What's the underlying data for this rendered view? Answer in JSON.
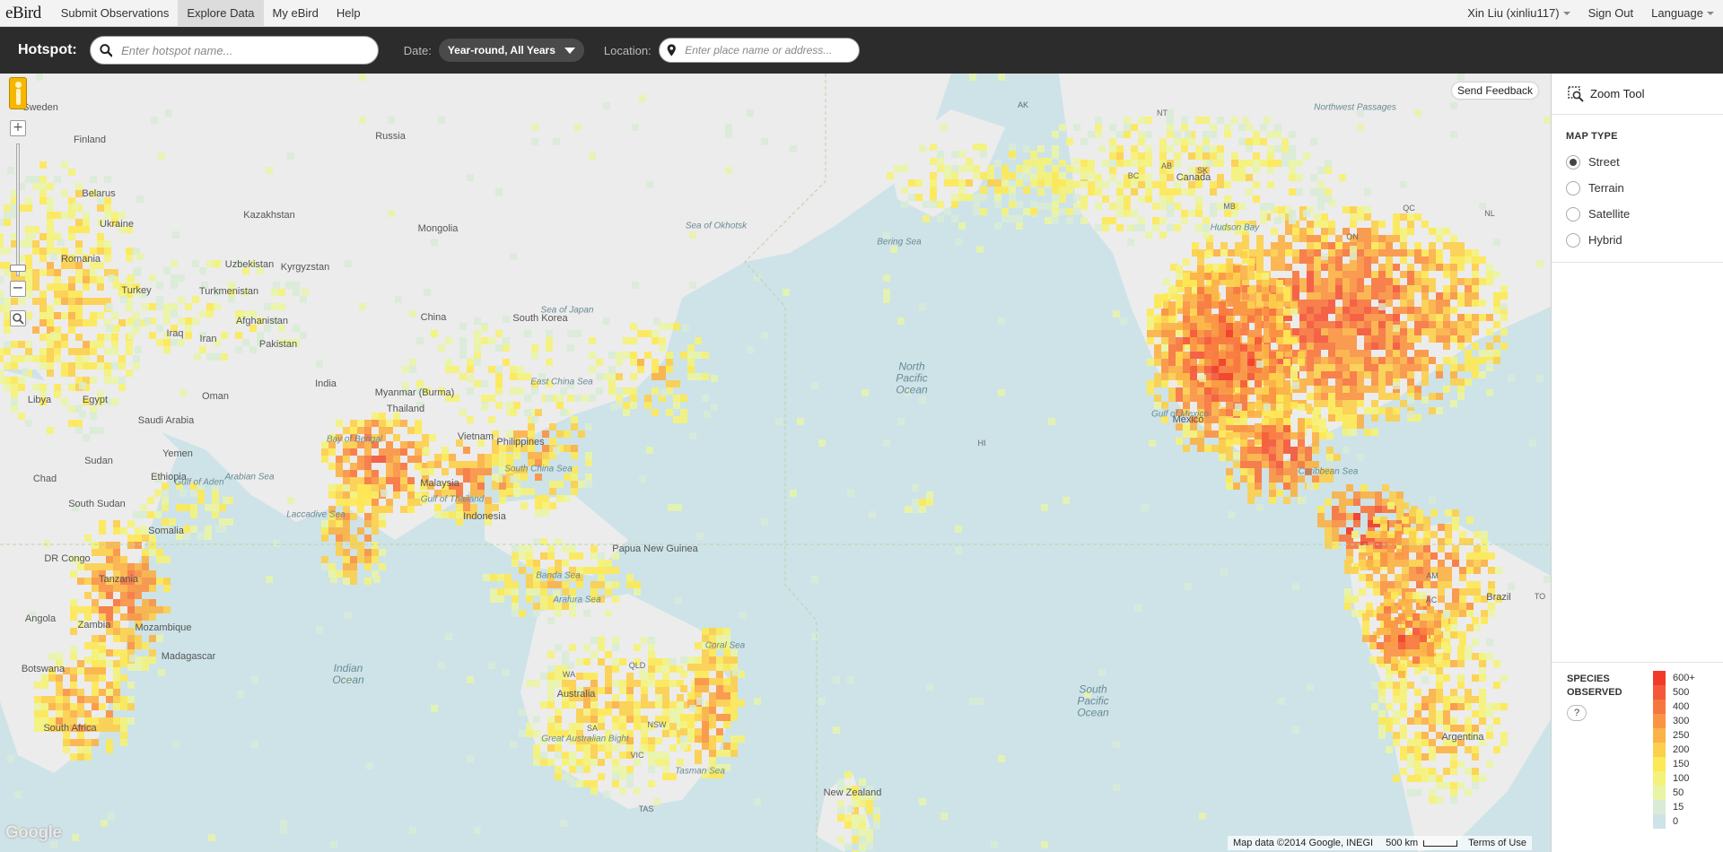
{
  "nav": {
    "logo": "eBird",
    "items": [
      {
        "label": "Submit Observations",
        "active": false
      },
      {
        "label": "Explore Data",
        "active": true
      },
      {
        "label": "My eBird",
        "active": false
      },
      {
        "label": "Help",
        "active": false
      }
    ],
    "user": "Xin Liu (xinliu117)",
    "sign_out": "Sign Out",
    "language": "Language"
  },
  "search": {
    "hotspot_label": "Hotspot:",
    "hotspot_placeholder": "Enter hotspot name...",
    "date_label": "Date:",
    "date_value": "Year-round, All Years",
    "location_label": "Location:",
    "location_placeholder": "Enter place name or address..."
  },
  "map": {
    "send_feedback": "Send Feedback",
    "attribution": "Map data ©2014 Google, INEGI",
    "scale": "500 km",
    "terms": "Terms of Use",
    "google_logo": "Google",
    "labels": {
      "countries": [
        "Russia",
        "Finland",
        "Sweden",
        "Belarus",
        "Ukraine",
        "Romania",
        "Turkey",
        "Kazakhstan",
        "Mongolia",
        "Uzbekistan",
        "Kyrgyzstan",
        "Turkmenistan",
        "Afghanistan",
        "Iran",
        "Iraq",
        "Pakistan",
        "China",
        "South Korea",
        "India",
        "Myanmar (Burma)",
        "Thailand",
        "Vietnam",
        "Philippines",
        "Malaysia",
        "Indonesia",
        "Papua New Guinea",
        "Australia",
        "New Zealand",
        "Libya",
        "Egypt",
        "Saudi Arabia",
        "Oman",
        "Yemen",
        "Sudan",
        "Chad",
        "Ethiopia",
        "South Sudan",
        "Somalia",
        "DR Congo",
        "Tanzania",
        "Angola",
        "Zambia",
        "Mozambique",
        "Madagascar",
        "Botswana",
        "South Africa",
        "Canada",
        "Mexico",
        "Brazil",
        "Argentina"
      ],
      "seas": [
        "Sea of Okhotsk",
        "Bering Sea",
        "Sea of Japan",
        "East China Sea",
        "South China Sea",
        "Bay of Bengal",
        "Arabian Sea",
        "Laccadive Sea",
        "Gulf of Aden",
        "Gulf of Thailand",
        "Banda Sea",
        "Arafura Sea",
        "Coral Sea",
        "Tasman Sea",
        "Great Australian Bight",
        "Gulf of Mexico",
        "Caribbean Sea",
        "Hudson Bay",
        "Northwest Passages"
      ],
      "oceans": [
        "North Pacific Ocean",
        "South Pacific Ocean",
        "Indian Ocean"
      ],
      "states": [
        "AK",
        "NT",
        "BC",
        "AB",
        "SK",
        "MB",
        "ON",
        "QC",
        "NL",
        "WA",
        "QLD",
        "NSW",
        "VIC",
        "SA",
        "TAS",
        "HI",
        "AM",
        "AC",
        "TO"
      ]
    }
  },
  "panel": {
    "zoom_tool": "Zoom Tool",
    "map_type_title": "MAP TYPE",
    "map_types": [
      {
        "label": "Street",
        "checked": true
      },
      {
        "label": "Terrain",
        "checked": false
      },
      {
        "label": "Satellite",
        "checked": false
      },
      {
        "label": "Hybrid",
        "checked": false
      }
    ],
    "species_title": "SPECIES OBSERVED",
    "help": "?",
    "legend": [
      {
        "label": "600+",
        "color": "#f03b2a"
      },
      {
        "label": "500",
        "color": "#f4573a"
      },
      {
        "label": "400",
        "color": "#f7763f"
      },
      {
        "label": "300",
        "color": "#fa9443"
      },
      {
        "label": "250",
        "color": "#fbb247"
      },
      {
        "label": "200",
        "color": "#fccf4d"
      },
      {
        "label": "150",
        "color": "#fde856"
      },
      {
        "label": "100",
        "color": "#f4f27a"
      },
      {
        "label": "50",
        "color": "#e9f4a6"
      },
      {
        "label": "15",
        "color": "#d9ebd6"
      },
      {
        "label": "0",
        "color": "#cde3e8"
      }
    ]
  },
  "colors": {
    "ocean": "#cde3e8",
    "land": "#ececec",
    "nav_bg": "#f3f3f3",
    "searchbar_bg": "#2c2c2c"
  }
}
